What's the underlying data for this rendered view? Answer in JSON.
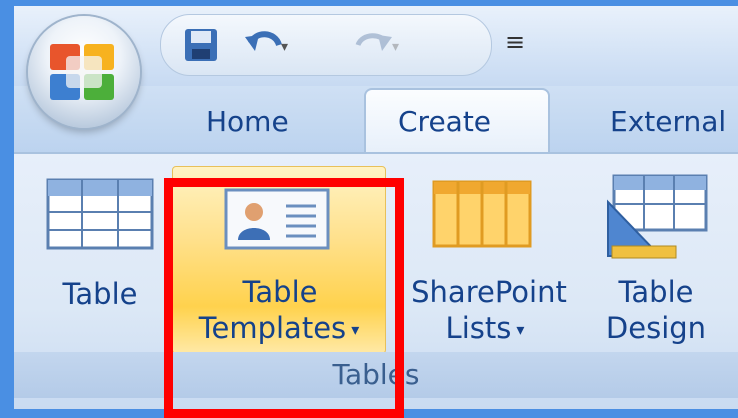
{
  "tabs": {
    "home": "Home",
    "create": "Create",
    "external": "External"
  },
  "ribbon": {
    "buttons": {
      "table": "Table",
      "table_templates_line1": "Table",
      "table_templates_line2": "Templates",
      "sharepoint_line1": "SharePoint",
      "sharepoint_line2": "Lists",
      "table_design_line1": "Table",
      "table_design_line2": "Design"
    },
    "group_label": "Tables"
  },
  "icons": {
    "office": "office-button-icon",
    "save": "save-icon",
    "undo": "undo-icon",
    "redo": "redo-icon",
    "customize": "customize-qat-icon",
    "table": "table-icon",
    "table_templates": "table-templates-icon",
    "sharepoint_lists": "sharepoint-lists-icon",
    "table_design": "table-design-icon"
  },
  "colors": {
    "background": "#4a8fe3",
    "tab_text": "#15428b",
    "highlight": "#ff0000",
    "hover": "#ffd24d"
  }
}
